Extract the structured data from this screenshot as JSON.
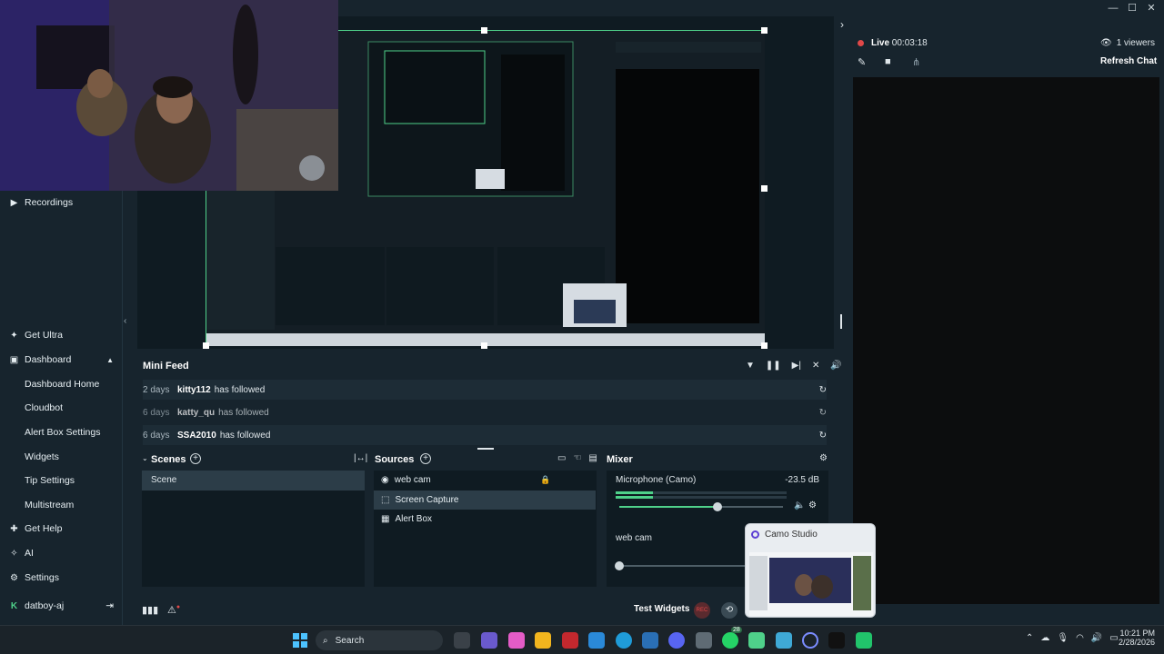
{
  "window": {
    "minimize": "—",
    "maximize": "☐",
    "close": "✕"
  },
  "nav": {
    "recordings": "Recordings",
    "get_ultra": "Get Ultra",
    "dashboard": "Dashboard",
    "dashboard_home": "Dashboard Home",
    "cloudbot": "Cloudbot",
    "alert_box_settings": "Alert Box Settings",
    "widgets": "Widgets",
    "tip_settings": "Tip Settings",
    "multistream": "Multistream",
    "get_help": "Get Help",
    "ai": "AI",
    "settings": "Settings",
    "user": "datboy-aj"
  },
  "live": {
    "status": "Live",
    "time": "00:03:18",
    "viewers": "1 viewers",
    "refresh": "Refresh Chat"
  },
  "minifeed": {
    "title": "Mini Feed",
    "rows": [
      {
        "age": "2 days",
        "name": "kitty112",
        "msg": "has followed"
      },
      {
        "age": "6 days",
        "name": "katty_qu",
        "msg": "has followed"
      },
      {
        "age": "6 days",
        "name": "SSA2010",
        "msg": "has followed"
      }
    ]
  },
  "scenes": {
    "title": "Scenes",
    "items": [
      "Scene"
    ]
  },
  "sources": {
    "title": "Sources",
    "items": [
      "web cam",
      "Screen Capture",
      "Alert Box"
    ]
  },
  "mixer": {
    "title": "Mixer",
    "channels": [
      {
        "name": "Microphone (Camo)",
        "db": "-23.5 dB",
        "level": 0.6
      },
      {
        "name": "web cam",
        "db": "",
        "level": 0.0
      }
    ]
  },
  "footer": {
    "test_widgets": "Test Widgets",
    "rec": "REC"
  },
  "camo": {
    "title": "Camo Studio"
  },
  "taskbar": {
    "search": "Search",
    "time": "10:21 PM",
    "date": "2/28/2026",
    "badge": "28"
  },
  "colors": {
    "accent": "#4fd18a",
    "bg": "#17242d",
    "dock_bg": "#0f1b22",
    "live_dot": "#e04848"
  }
}
